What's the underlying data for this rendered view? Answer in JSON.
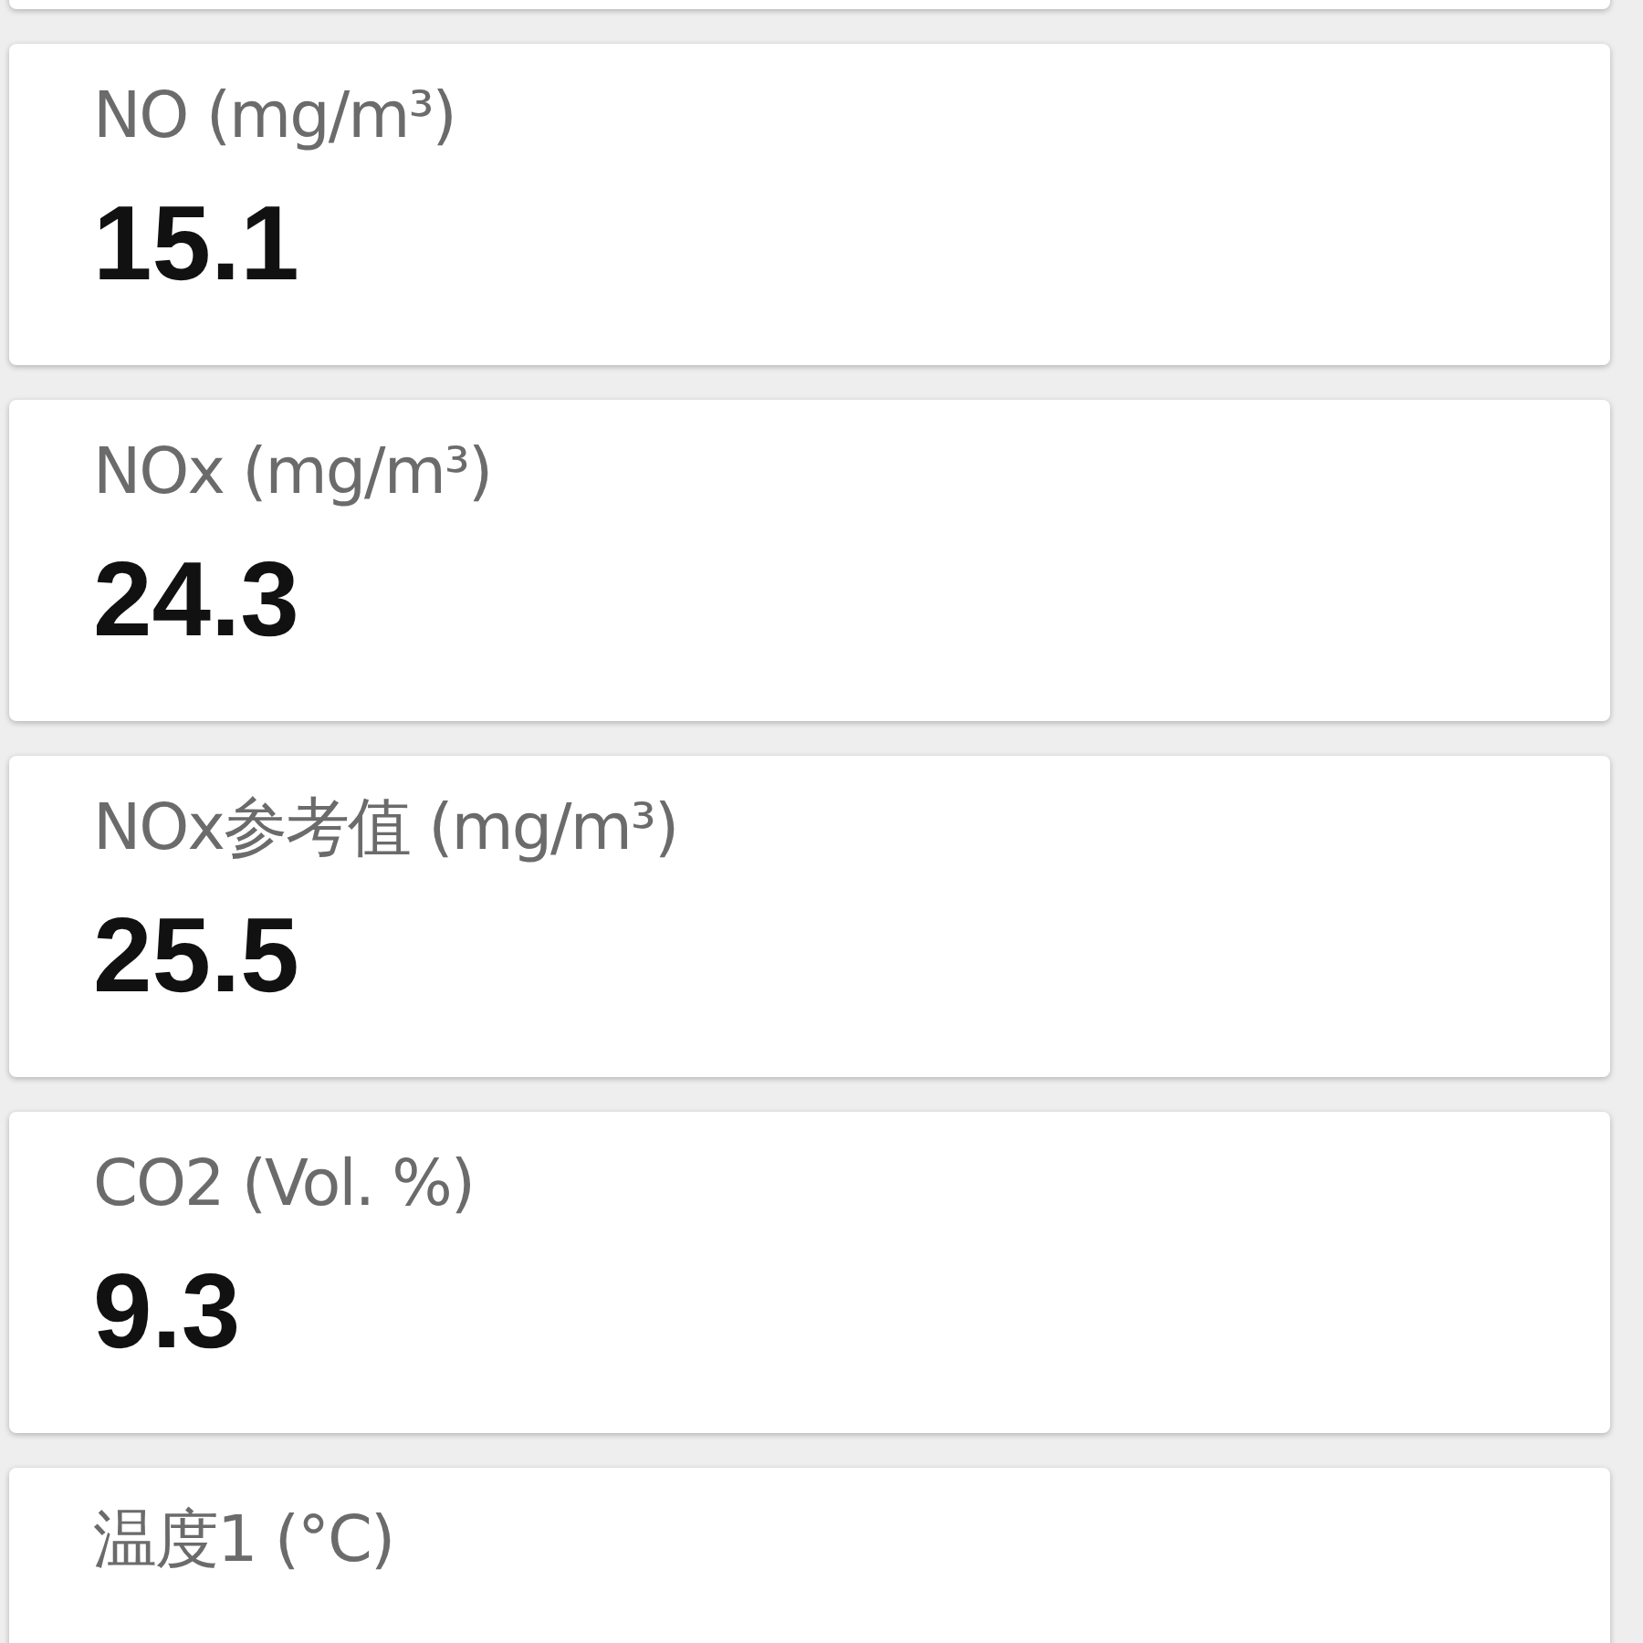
{
  "readings": [
    {
      "label": "NO (mg/m³)",
      "value": "15.1"
    },
    {
      "label": "NOx (mg/m³)",
      "value": "24.3"
    },
    {
      "label": "NOx参考值 (mg/m³)",
      "value": "25.5"
    },
    {
      "label": "CO2 (Vol. %)",
      "value": "9.3"
    },
    {
      "label": "温度1 (°C)"
    }
  ]
}
